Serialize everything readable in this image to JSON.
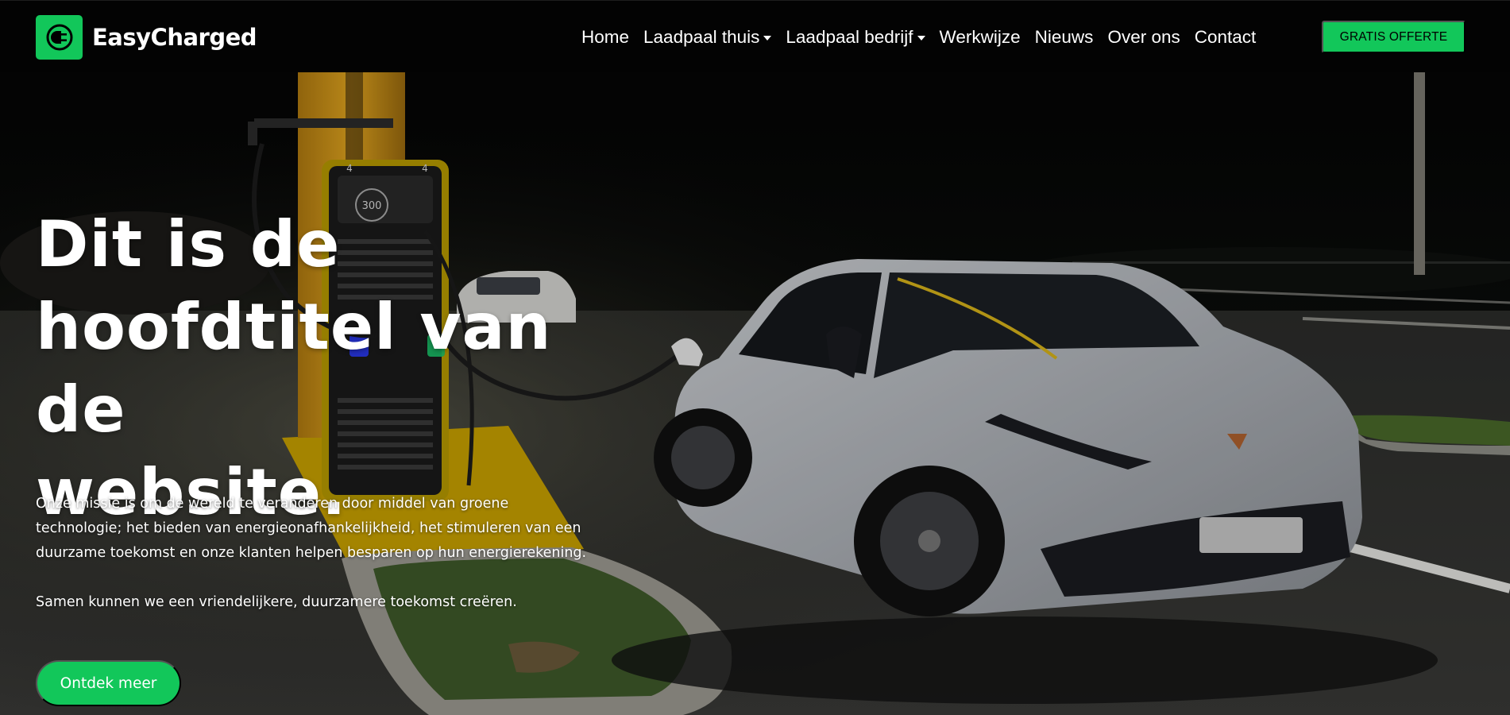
{
  "brand": {
    "name": "EasyCharged",
    "logo_icon": "ev-plug-icon",
    "color": "#12c75a"
  },
  "nav": {
    "items": [
      {
        "label": "Home",
        "has_dropdown": false
      },
      {
        "label": "Laadpaal thuis",
        "has_dropdown": true
      },
      {
        "label": "Laadpaal bedrijf",
        "has_dropdown": true
      },
      {
        "label": "Werkwijze",
        "has_dropdown": false
      },
      {
        "label": "Nieuws",
        "has_dropdown": false
      },
      {
        "label": "Over ons",
        "has_dropdown": false
      },
      {
        "label": "Contact",
        "has_dropdown": false
      }
    ],
    "cta_label": "GRATIS OFFERTE"
  },
  "hero": {
    "title_lines": [
      "Dit is de",
      "hoofdtitel van de",
      "website."
    ],
    "paragraph_lines": [
      "Onze missie is om de wereld te veranderen door middel van groene",
      "technologie; het bieden van energieonafhankelijkheid, het stimuleren van een",
      "duurzame toekomst en onze klanten helpen besparen op hun energierekening."
    ],
    "paragraph2": "Samen kunnen we een vriendelijkere, duurzamere toekomst creëren.",
    "button_label": "Ontdek meer",
    "charger_display": "300",
    "charger_labels": [
      "4",
      "4"
    ],
    "background_image": "night-ev-charging-station-photo"
  },
  "colors": {
    "accent": "#12c75a",
    "navbar_bg": "#030303",
    "charger_yellow": "#f2c200"
  }
}
